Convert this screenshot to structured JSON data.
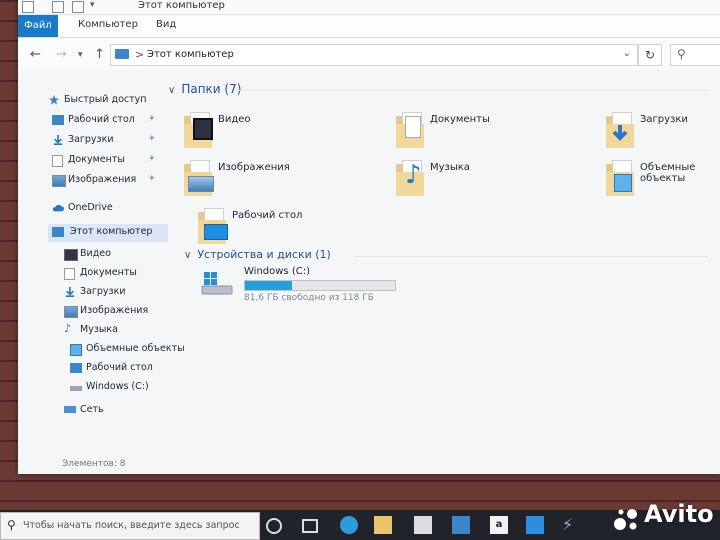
{
  "window": {
    "title": "Этот компьютер"
  },
  "ribbon": {
    "tabs": [
      "Файл",
      "Компьютер",
      "Вид"
    ]
  },
  "address": {
    "path": "Этот компьютер",
    "separator": ">",
    "search_placeholder": ""
  },
  "sidebar": {
    "quick_access": "Быстрый доступ",
    "quick_items": [
      "Рабочий стол",
      "Загрузки",
      "Документы",
      "Изображения"
    ],
    "onedrive": "OneDrive",
    "this_pc": "Этот компьютер",
    "pc_items": [
      "Видео",
      "Документы",
      "Загрузки",
      "Изображения",
      "Музыка",
      "Объемные объекты",
      "Рабочий стол",
      "Windows (C:)"
    ],
    "network": "Сеть"
  },
  "content": {
    "folders_header": "Папки (7)",
    "folders": [
      "Видео",
      "Документы",
      "Загрузки",
      "Изображения",
      "Музыка",
      "Объемные объекты",
      "Рабочий стол"
    ],
    "devices_header": "Устройства и диски (1)",
    "drive": {
      "name": "Windows (C:)",
      "free_text": "81,6 ГБ свободно из 118 ГБ",
      "used_fraction": 0.31
    }
  },
  "status": {
    "items_count": "Элементов: 8"
  },
  "taskbar": {
    "search_placeholder": "Чтобы начать поиск, введите здесь запрос"
  },
  "watermark": "Avito",
  "colors": {
    "accent": "#1979ca",
    "header": "#1f4f9c",
    "drive_fill": "#26a0da"
  }
}
